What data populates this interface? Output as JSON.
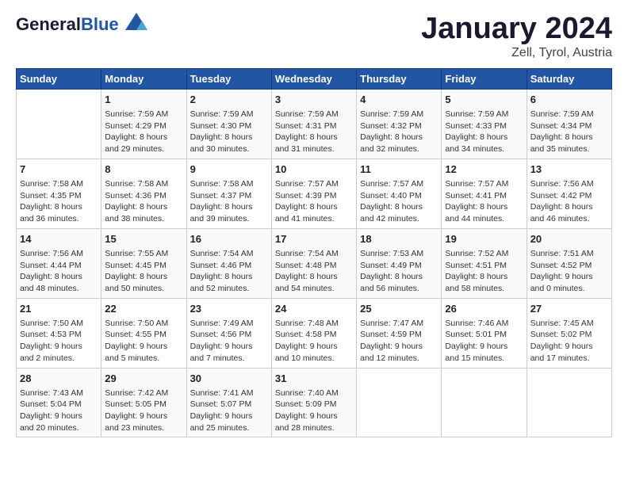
{
  "header": {
    "logo_general": "General",
    "logo_blue": "Blue",
    "title": "January 2024",
    "subtitle": "Zell, Tyrol, Austria"
  },
  "days_of_week": [
    "Sunday",
    "Monday",
    "Tuesday",
    "Wednesday",
    "Thursday",
    "Friday",
    "Saturday"
  ],
  "weeks": [
    [
      {
        "day": "",
        "content": ""
      },
      {
        "day": "1",
        "content": "Sunrise: 7:59 AM\nSunset: 4:29 PM\nDaylight: 8 hours\nand 29 minutes."
      },
      {
        "day": "2",
        "content": "Sunrise: 7:59 AM\nSunset: 4:30 PM\nDaylight: 8 hours\nand 30 minutes."
      },
      {
        "day": "3",
        "content": "Sunrise: 7:59 AM\nSunset: 4:31 PM\nDaylight: 8 hours\nand 31 minutes."
      },
      {
        "day": "4",
        "content": "Sunrise: 7:59 AM\nSunset: 4:32 PM\nDaylight: 8 hours\nand 32 minutes."
      },
      {
        "day": "5",
        "content": "Sunrise: 7:59 AM\nSunset: 4:33 PM\nDaylight: 8 hours\nand 34 minutes."
      },
      {
        "day": "6",
        "content": "Sunrise: 7:59 AM\nSunset: 4:34 PM\nDaylight: 8 hours\nand 35 minutes."
      }
    ],
    [
      {
        "day": "7",
        "content": "Sunrise: 7:58 AM\nSunset: 4:35 PM\nDaylight: 8 hours\nand 36 minutes."
      },
      {
        "day": "8",
        "content": "Sunrise: 7:58 AM\nSunset: 4:36 PM\nDaylight: 8 hours\nand 38 minutes."
      },
      {
        "day": "9",
        "content": "Sunrise: 7:58 AM\nSunset: 4:37 PM\nDaylight: 8 hours\nand 39 minutes."
      },
      {
        "day": "10",
        "content": "Sunrise: 7:57 AM\nSunset: 4:39 PM\nDaylight: 8 hours\nand 41 minutes."
      },
      {
        "day": "11",
        "content": "Sunrise: 7:57 AM\nSunset: 4:40 PM\nDaylight: 8 hours\nand 42 minutes."
      },
      {
        "day": "12",
        "content": "Sunrise: 7:57 AM\nSunset: 4:41 PM\nDaylight: 8 hours\nand 44 minutes."
      },
      {
        "day": "13",
        "content": "Sunrise: 7:56 AM\nSunset: 4:42 PM\nDaylight: 8 hours\nand 46 minutes."
      }
    ],
    [
      {
        "day": "14",
        "content": "Sunrise: 7:56 AM\nSunset: 4:44 PM\nDaylight: 8 hours\nand 48 minutes."
      },
      {
        "day": "15",
        "content": "Sunrise: 7:55 AM\nSunset: 4:45 PM\nDaylight: 8 hours\nand 50 minutes."
      },
      {
        "day": "16",
        "content": "Sunrise: 7:54 AM\nSunset: 4:46 PM\nDaylight: 8 hours\nand 52 minutes."
      },
      {
        "day": "17",
        "content": "Sunrise: 7:54 AM\nSunset: 4:48 PM\nDaylight: 8 hours\nand 54 minutes."
      },
      {
        "day": "18",
        "content": "Sunrise: 7:53 AM\nSunset: 4:49 PM\nDaylight: 8 hours\nand 56 minutes."
      },
      {
        "day": "19",
        "content": "Sunrise: 7:52 AM\nSunset: 4:51 PM\nDaylight: 8 hours\nand 58 minutes."
      },
      {
        "day": "20",
        "content": "Sunrise: 7:51 AM\nSunset: 4:52 PM\nDaylight: 9 hours\nand 0 minutes."
      }
    ],
    [
      {
        "day": "21",
        "content": "Sunrise: 7:50 AM\nSunset: 4:53 PM\nDaylight: 9 hours\nand 2 minutes."
      },
      {
        "day": "22",
        "content": "Sunrise: 7:50 AM\nSunset: 4:55 PM\nDaylight: 9 hours\nand 5 minutes."
      },
      {
        "day": "23",
        "content": "Sunrise: 7:49 AM\nSunset: 4:56 PM\nDaylight: 9 hours\nand 7 minutes."
      },
      {
        "day": "24",
        "content": "Sunrise: 7:48 AM\nSunset: 4:58 PM\nDaylight: 9 hours\nand 10 minutes."
      },
      {
        "day": "25",
        "content": "Sunrise: 7:47 AM\nSunset: 4:59 PM\nDaylight: 9 hours\nand 12 minutes."
      },
      {
        "day": "26",
        "content": "Sunrise: 7:46 AM\nSunset: 5:01 PM\nDaylight: 9 hours\nand 15 minutes."
      },
      {
        "day": "27",
        "content": "Sunrise: 7:45 AM\nSunset: 5:02 PM\nDaylight: 9 hours\nand 17 minutes."
      }
    ],
    [
      {
        "day": "28",
        "content": "Sunrise: 7:43 AM\nSunset: 5:04 PM\nDaylight: 9 hours\nand 20 minutes."
      },
      {
        "day": "29",
        "content": "Sunrise: 7:42 AM\nSunset: 5:05 PM\nDaylight: 9 hours\nand 23 minutes."
      },
      {
        "day": "30",
        "content": "Sunrise: 7:41 AM\nSunset: 5:07 PM\nDaylight: 9 hours\nand 25 minutes."
      },
      {
        "day": "31",
        "content": "Sunrise: 7:40 AM\nSunset: 5:09 PM\nDaylight: 9 hours\nand 28 minutes."
      },
      {
        "day": "",
        "content": ""
      },
      {
        "day": "",
        "content": ""
      },
      {
        "day": "",
        "content": ""
      }
    ]
  ]
}
